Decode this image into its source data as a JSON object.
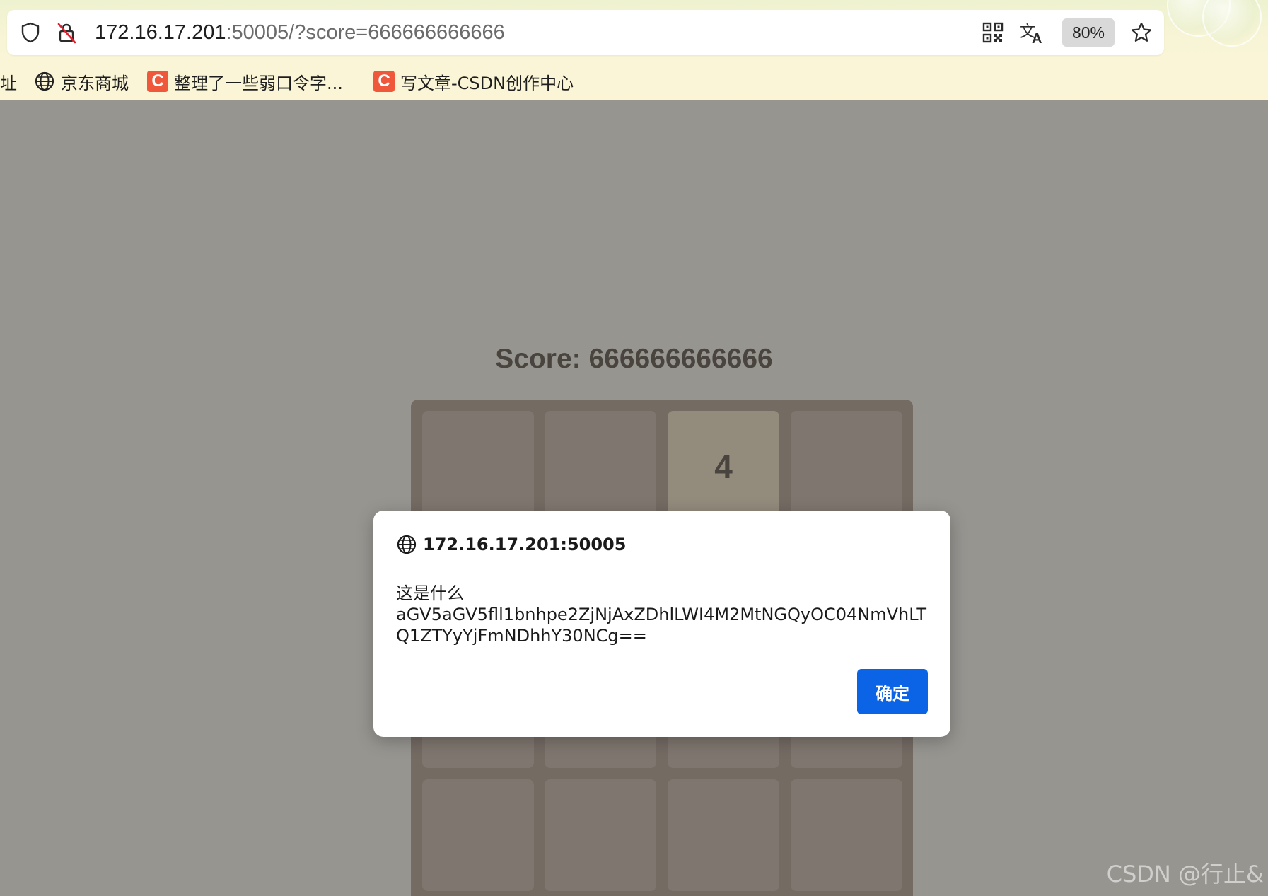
{
  "browser": {
    "url_host": "172.16.17.201",
    "url_rest": ":50005/?score=666666666666",
    "zoom": "80%",
    "icons": {
      "site_info": "shield-icon",
      "insecure": "insecure-lock-icon",
      "qr": "qr-code-icon",
      "translate": "translate-icon",
      "favorite": "star-icon"
    }
  },
  "bookmarks": [
    {
      "label": "址",
      "icon": "none"
    },
    {
      "label": "京东商城",
      "icon": "globe-icon"
    },
    {
      "label": "整理了一些弱口令字...",
      "icon": "csdn-icon",
      "icon_text": "C"
    },
    {
      "label": "写文章-CSDN创作中心",
      "icon": "csdn-icon",
      "icon_text": "C"
    }
  ],
  "game": {
    "score_text": "Score: 666666666666",
    "grid": [
      [
        "",
        "",
        "4",
        ""
      ],
      [
        "",
        "",
        "",
        ""
      ],
      [
        "",
        "",
        "",
        ""
      ],
      [
        "",
        "",
        "",
        ""
      ]
    ],
    "colors": {
      "board": "#bbada0",
      "empty_cell": "#cdc1b4",
      "tile_4": "#ede0c8",
      "text": "#776e65"
    }
  },
  "dialog": {
    "origin": "172.16.17.201:50005",
    "message": "这是什么\naGV5aGV5fll1bnhpe2ZjNjAxZDhlLWI4M2MtNGQyOC04NmVhLTQ1ZTYyYjFmNDhhY30NCg==",
    "ok_label": "确定",
    "ok_color": "#0b63e5"
  },
  "watermark": "CSDN @行止&"
}
